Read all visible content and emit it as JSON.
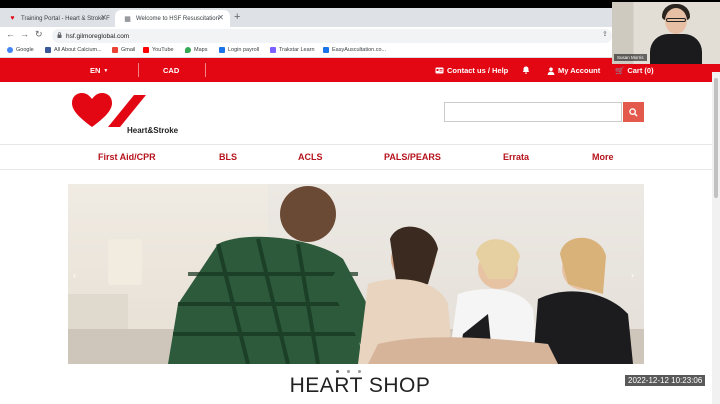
{
  "browser": {
    "tabs": [
      {
        "label": "Training Portal - Heart & Stroke F"
      },
      {
        "label": "Welcome to HSF Resuscitation"
      }
    ],
    "url": "hsf.gilmoreglobal.com",
    "bookmarks": [
      {
        "label": "Google",
        "color": "#4285f4"
      },
      {
        "label": "All About Calcium...",
        "color": "#3b5998"
      },
      {
        "label": "Gmail",
        "color": "#ea4335"
      },
      {
        "label": "YouTube",
        "color": "#ff0000"
      },
      {
        "label": "Maps",
        "color": "#34a853"
      },
      {
        "label": "Login payroll",
        "color": "#1a73e8"
      },
      {
        "label": "Trakstar Learn",
        "color": "#7b61ff"
      },
      {
        "label": "EasyAuscultation.co...",
        "color": "#1a73e8"
      }
    ]
  },
  "webcam": {
    "name": "Susan Morris"
  },
  "topbar": {
    "language": "EN",
    "currency": "CAD",
    "contact": "Contact us / Help",
    "account": "My Account",
    "cart": "Cart (0)"
  },
  "logo": {
    "text": "Heart&Stroke"
  },
  "search": {
    "placeholder": ""
  },
  "nav": {
    "items": [
      "First Aid/CPR",
      "BLS",
      "ACLS",
      "PALS/PEARS",
      "Errata",
      "More"
    ]
  },
  "hero": {
    "alt": ""
  },
  "page": {
    "heading": "HEART SHOP"
  },
  "overlay": {
    "timestamp": "2022-12-12  10:23:06"
  },
  "colors": {
    "brand_red": "#e30613",
    "nav_red": "#b5121b",
    "search_btn": "#e35a4d"
  }
}
